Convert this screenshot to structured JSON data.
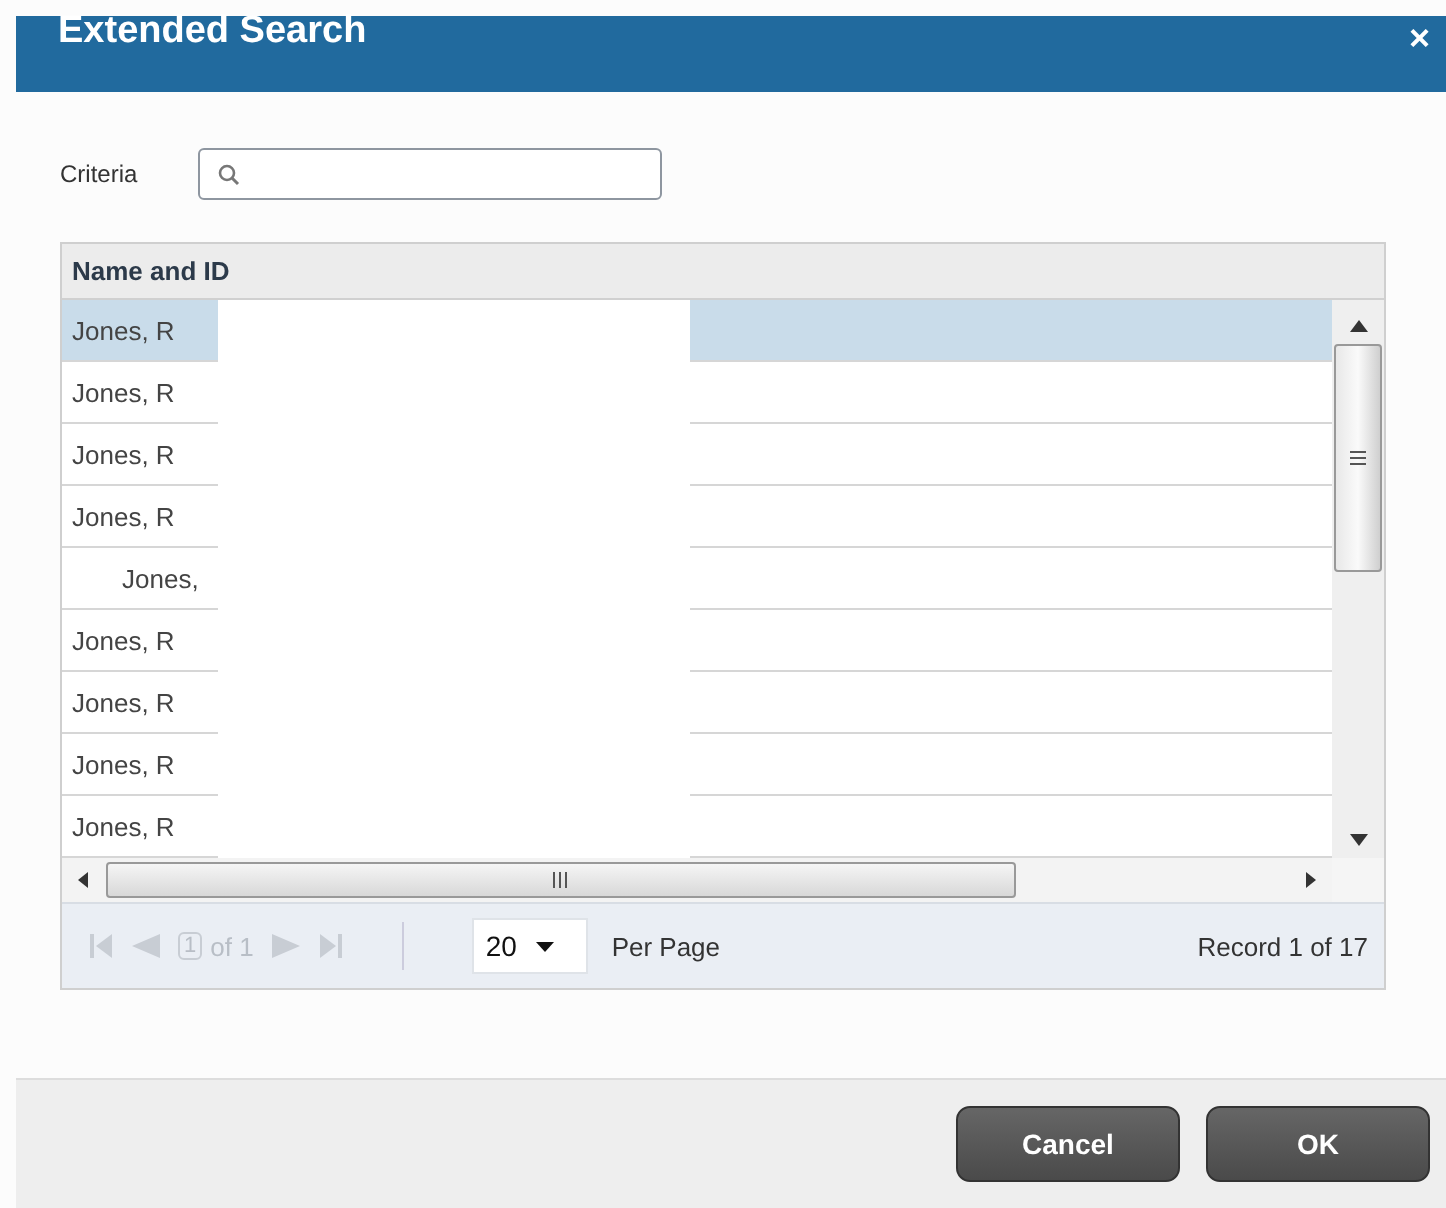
{
  "dialog": {
    "title": "Extended Search",
    "close": "×"
  },
  "criteria": {
    "label": "Criteria"
  },
  "table": {
    "columns": [
      "Name and ID"
    ],
    "rows": [
      {
        "text": "Jones, R",
        "selected": true,
        "indented": false
      },
      {
        "text": "Jones, R",
        "selected": false,
        "indented": false
      },
      {
        "text": "Jones, R",
        "selected": false,
        "indented": false
      },
      {
        "text": "Jones, R",
        "selected": false,
        "indented": false
      },
      {
        "text": "Jones,",
        "selected": false,
        "indented": true
      },
      {
        "text": "Jones, R",
        "selected": false,
        "indented": false
      },
      {
        "text": "Jones, R",
        "selected": false,
        "indented": false
      },
      {
        "text": "Jones, R",
        "selected": false,
        "indented": false
      },
      {
        "text": "Jones, R",
        "selected": false,
        "indented": false
      }
    ]
  },
  "pager": {
    "page": "1",
    "of": "of 1",
    "per_page": "20",
    "per_page_label": "Per Page",
    "record": "Record 1 of 17"
  },
  "buttons": [
    "Cancel",
    "OK"
  ]
}
